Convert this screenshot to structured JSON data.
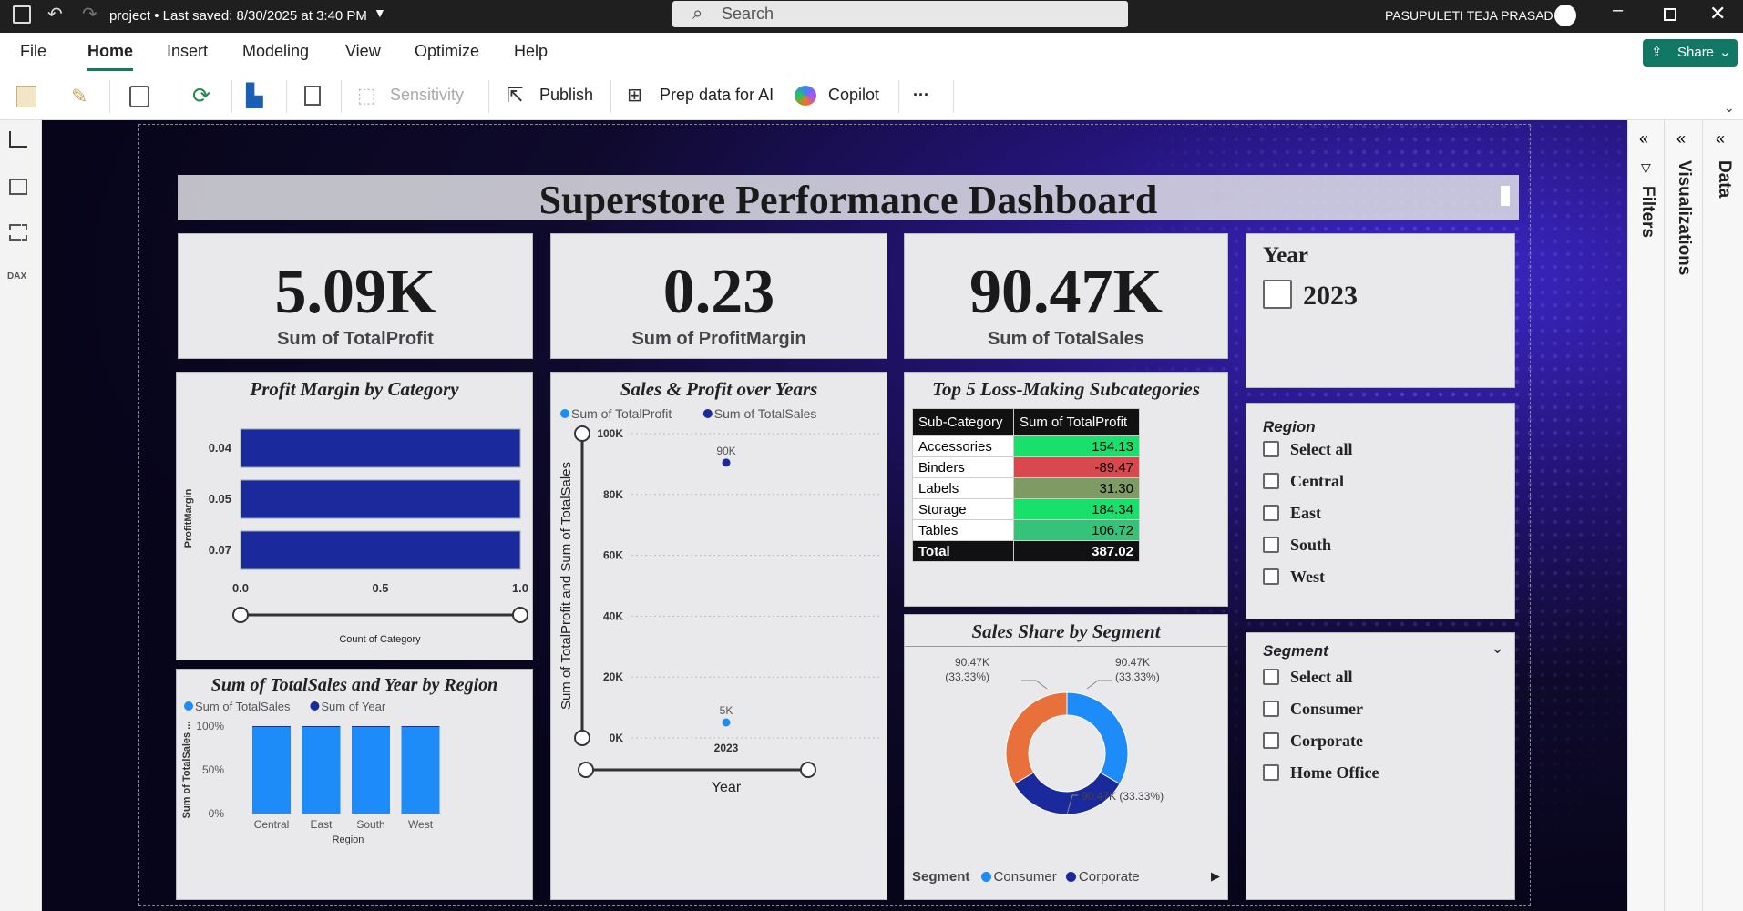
{
  "titlebar": {
    "doc_title": "project • Last saved: 8/30/2025 at 3:40 PM",
    "search_placeholder": "Search",
    "user_name": "PASUPULETI TEJA PRASAD"
  },
  "menu": [
    "File",
    "Home",
    "Insert",
    "Modeling",
    "View",
    "Optimize",
    "Help"
  ],
  "share_label": "Share",
  "toolbar": {
    "sensitivity": "Sensitivity",
    "publish": "Publish",
    "prep": "Prep data for AI",
    "copilot": "Copilot",
    "more": "···"
  },
  "right_panes": [
    "Filters",
    "Visualizations",
    "Data"
  ],
  "dashboard": {
    "title": "Superstore Performance Dashboard",
    "kpis": [
      {
        "value": "5.09K",
        "label": "Sum of TotalProfit"
      },
      {
        "value": "0.23",
        "label": "Sum of ProfitMargin"
      },
      {
        "value": "90.47K",
        "label": "Sum of TotalSales"
      }
    ],
    "year_slicer": {
      "title": "Year",
      "items": [
        "2023"
      ]
    },
    "region_slicer": {
      "title": "Region",
      "items": [
        "Select all",
        "Central",
        "East",
        "South",
        "West"
      ]
    },
    "segment_slicer": {
      "title": "Segment",
      "items": [
        "Select all",
        "Consumer",
        "Corporate",
        "Home Office"
      ]
    },
    "loss_table": {
      "title": "Top 5 Loss-Making Subcategories",
      "headers": [
        "Sub-Category",
        "Sum of TotalProfit"
      ],
      "rows": [
        [
          "Accessories",
          "154.13"
        ],
        [
          "Binders",
          "-89.47"
        ],
        [
          "Labels",
          "31.30"
        ],
        [
          "Storage",
          "184.34"
        ],
        [
          "Tables",
          "106.72"
        ]
      ],
      "row_colors": [
        "#19e06b",
        "#d9484f",
        "#7f9a62",
        "#19e06b",
        "#35c37a"
      ],
      "total": [
        "Total",
        "387.02"
      ]
    }
  },
  "chart_data": [
    {
      "type": "bar",
      "title": "Profit Margin by Category",
      "orientation": "horizontal",
      "categories": [
        "0.04",
        "0.05",
        "0.07"
      ],
      "values": [
        1,
        1,
        1
      ],
      "xlabel": "Count of Category",
      "ylabel": "ProfitMargin",
      "xticks": [
        "0.0",
        "0.5",
        "1.0"
      ],
      "xlim": [
        0,
        1
      ],
      "color": "#1a2a9c"
    },
    {
      "type": "bar",
      "title": "Sum of TotalSales and Year by Region",
      "stacked_percent": true,
      "categories": [
        "Central",
        "East",
        "South",
        "West"
      ],
      "series": [
        {
          "name": "Sum of TotalSales",
          "values": [
            99,
            99,
            99,
            99
          ],
          "color": "#1d8cf8"
        },
        {
          "name": "Sum of Year",
          "values": [
            1,
            1,
            1,
            1
          ],
          "color": "#1a2a9c"
        }
      ],
      "yticks": [
        "0%",
        "50%",
        "100%"
      ],
      "xlabel": "Region",
      "ylabel": "Sum of TotalSales ..."
    },
    {
      "type": "scatter",
      "title": "Sales & Profit over Years",
      "x": [
        "2023"
      ],
      "series": [
        {
          "name": "Sum of TotalProfit",
          "values": [
            5090
          ],
          "label": "5K",
          "color": "#1d8cf8"
        },
        {
          "name": "Sum of TotalSales",
          "values": [
            90470
          ],
          "label": "90K",
          "color": "#1a2a9c"
        }
      ],
      "ylim": [
        0,
        100000
      ],
      "yticks": [
        "0K",
        "20K",
        "40K",
        "60K",
        "80K",
        "100K"
      ],
      "xlabel": "Year",
      "ylabel": "Sum of TotalProfit and Sum of TotalSales"
    },
    {
      "type": "pie",
      "donut": true,
      "title": "Sales Share by Segment",
      "categories": [
        "Consumer",
        "Corporate",
        "Home Office"
      ],
      "values": [
        90.47,
        90.47,
        90.47
      ],
      "labels": [
        "90.47K (33.33%)",
        "90.47K (33.33%)",
        "90.47K (33.33%)"
      ],
      "colors": [
        "#1d8cf8",
        "#1a2a9c",
        "#e8703a"
      ],
      "legend_title": "Segment",
      "legend_visible": [
        "Consumer",
        "Corporate"
      ]
    }
  ]
}
